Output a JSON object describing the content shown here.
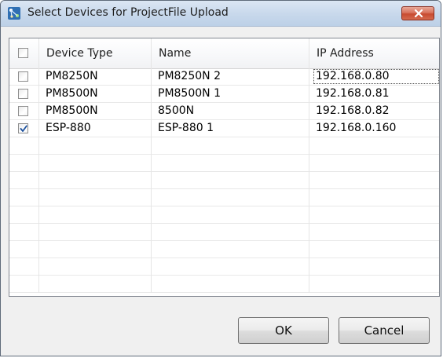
{
  "window": {
    "title": "Select Devices for ProjectFile Upload",
    "title_icon": "network-devices-icon",
    "close_icon": "close-x-icon"
  },
  "table": {
    "columns": [
      "Device Type",
      "Name",
      "IP Address"
    ],
    "rows": [
      {
        "checked": false,
        "device_type": "PM8250N",
        "name": "PM8250N 2",
        "ip": "192.168.0.80"
      },
      {
        "checked": false,
        "device_type": "PM8500N",
        "name": "PM8500N 1",
        "ip": "192.168.0.81"
      },
      {
        "checked": false,
        "device_type": "PM8500N",
        "name": "8500N",
        "ip": "192.168.0.82"
      },
      {
        "checked": true,
        "device_type": "ESP-880",
        "name": "ESP-880 1",
        "ip": "192.168.0.160"
      }
    ],
    "select_all_checked": false
  },
  "buttons": {
    "ok_label": "OK",
    "cancel_label": "Cancel"
  },
  "colors": {
    "titlebar": "#c9d9ec",
    "close_button": "#c84b30",
    "check_mark": "#1a4f9c"
  }
}
